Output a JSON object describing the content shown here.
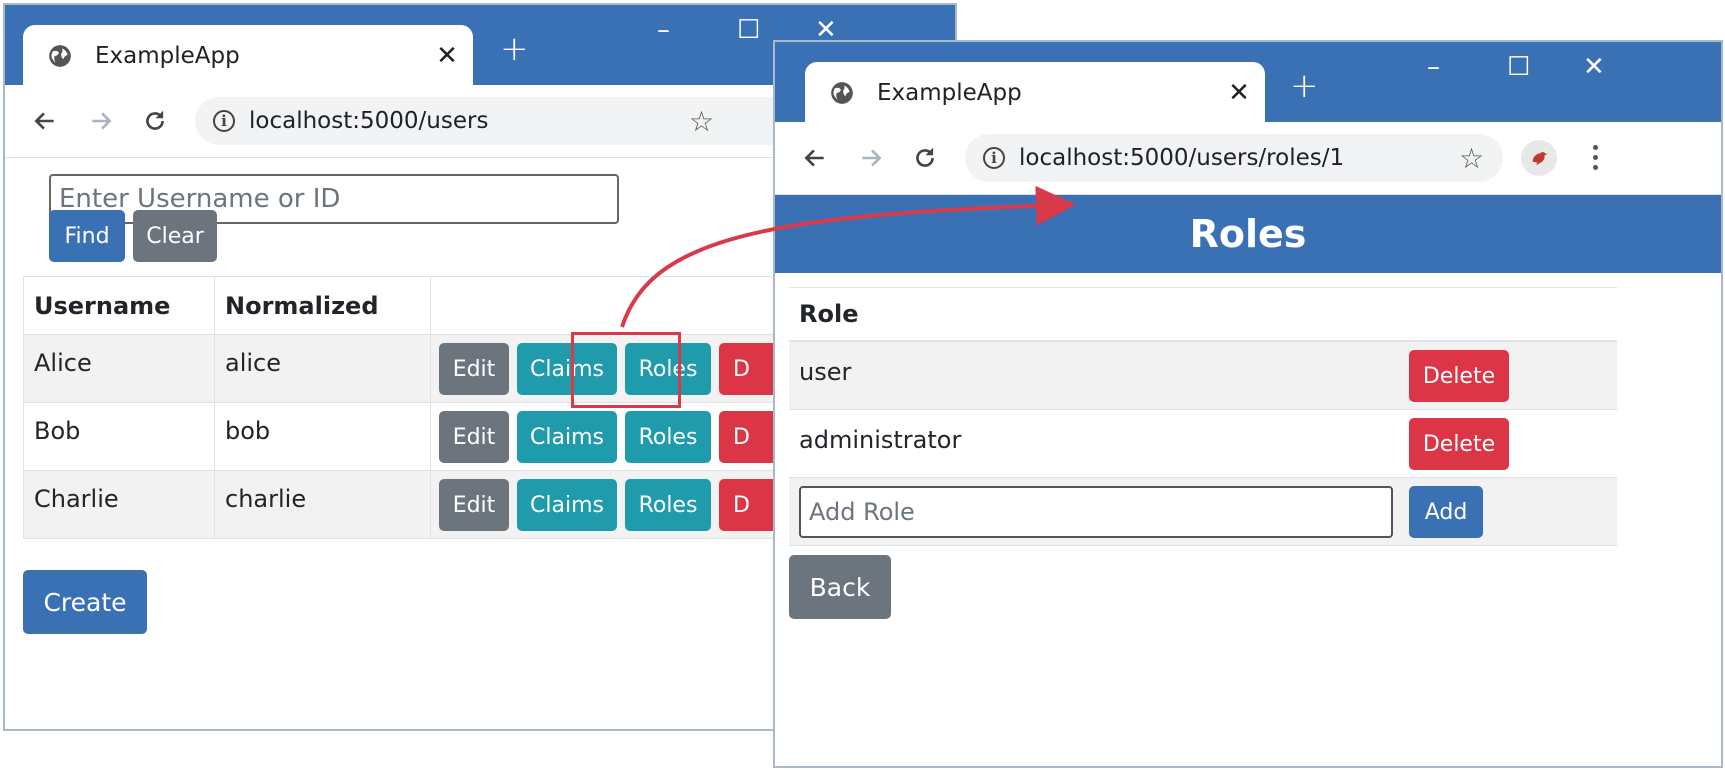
{
  "windows": [
    {
      "tab_title": "ExampleApp",
      "url": "localhost:5000/users",
      "search": {
        "placeholder": "Enter Username or ID",
        "value": ""
      },
      "find_label": "Find",
      "clear_label": "Clear",
      "table": {
        "headers": [
          "Username",
          "Normalized"
        ],
        "rows": [
          {
            "username": "Alice",
            "normalized": "alice"
          },
          {
            "username": "Bob",
            "normalized": "bob"
          },
          {
            "username": "Charlie",
            "normalized": "charlie"
          }
        ],
        "actions": {
          "edit": "Edit",
          "claims": "Claims",
          "roles": "Roles",
          "delete_partial": "D"
        }
      },
      "create_label": "Create"
    },
    {
      "tab_title": "ExampleApp",
      "url": "localhost:5000/users/roles/1",
      "banner_title": "Roles",
      "table_header": "Role",
      "roles": [
        {
          "name": "user",
          "delete_label": "Delete"
        },
        {
          "name": "administrator",
          "delete_label": "Delete"
        }
      ],
      "add_role": {
        "placeholder": "Add Role",
        "value": "",
        "button_label": "Add"
      },
      "back_label": "Back"
    }
  ],
  "icons": {
    "tab_icon": "globe-icon",
    "close": "close-icon",
    "new_tab": "plus-icon",
    "back": "arrow-left-icon",
    "forward": "arrow-right-icon",
    "reload": "reload-icon",
    "site_info": "info-icon",
    "bookmark": "star-icon",
    "profile": "profile-avatar-icon",
    "menu": "kebab-menu-icon"
  },
  "colors": {
    "brand_blue": "#3a71b5",
    "info": "#1f9bac",
    "danger": "#dc3545",
    "secondary": "#6c757d",
    "callout": "#d93a4a"
  }
}
